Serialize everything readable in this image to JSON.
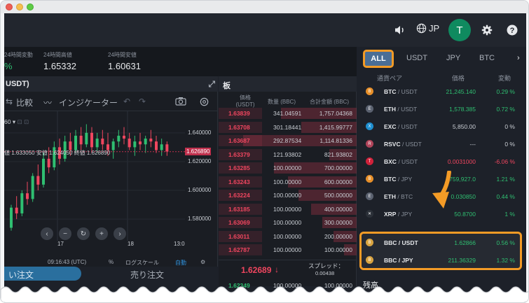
{
  "header": {
    "lang": "JP",
    "avatar_initial": "T"
  },
  "stats": {
    "change_label": "24時間変動",
    "change_value": "%",
    "high_label": "24時間高値",
    "high_value": "1.65332",
    "low_label": "24時間安値",
    "low_value": "1.60631"
  },
  "chart": {
    "title": "USDT)",
    "compare_label": "比較",
    "indicator_label": "インジケーター",
    "interval": "60",
    "ohlc_text": "値 1.633050  安値 1.624050  終値 1.626890",
    "current_price": "1.626890",
    "price_ticks": [
      "1.640000",
      "1.620000",
      "1.600000",
      "1.580000"
    ],
    "x_ticks": [
      "17",
      "18",
      "13:0"
    ],
    "time": "09:16:43 (UTC)",
    "pct": "%",
    "log_label": "ログスケール",
    "auto_label": "自動"
  },
  "chart_data": {
    "type": "candlestick",
    "title": "",
    "ylabel": "",
    "ylim": [
      1.565,
      1.655
    ],
    "categories": [
      "17",
      "18",
      "13:0"
    ],
    "series": [
      {
        "values": [
          [
            1.574,
            1.59,
            1.572,
            1.588
          ],
          [
            1.588,
            1.596,
            1.58,
            1.584
          ],
          [
            1.584,
            1.6,
            1.582,
            1.598
          ],
          [
            1.598,
            1.606,
            1.59,
            1.594
          ],
          [
            1.594,
            1.612,
            1.592,
            1.61
          ],
          [
            1.61,
            1.618,
            1.6,
            1.604
          ],
          [
            1.604,
            1.626,
            1.602,
            1.622
          ],
          [
            1.622,
            1.63,
            1.612,
            1.616
          ],
          [
            1.616,
            1.634,
            1.614,
            1.63
          ],
          [
            1.63,
            1.636,
            1.618,
            1.622
          ],
          [
            1.622,
            1.638,
            1.62,
            1.634
          ],
          [
            1.634,
            1.64,
            1.624,
            1.628
          ],
          [
            1.628,
            1.642,
            1.626,
            1.638
          ],
          [
            1.638,
            1.644,
            1.628,
            1.632
          ],
          [
            1.632,
            1.646,
            1.63,
            1.64
          ],
          [
            1.64,
            1.644,
            1.626,
            1.63
          ],
          [
            1.63,
            1.64,
            1.626,
            1.636
          ],
          [
            1.636,
            1.642,
            1.628,
            1.632
          ],
          [
            1.632,
            1.64,
            1.624,
            1.628
          ],
          [
            1.628,
            1.636,
            1.622,
            1.634
          ],
          [
            1.634,
            1.642,
            1.63,
            1.638
          ],
          [
            1.638,
            1.644,
            1.632,
            1.636
          ],
          [
            1.636,
            1.64,
            1.628,
            1.63
          ],
          [
            1.63,
            1.638,
            1.624,
            1.634
          ],
          [
            1.634,
            1.64,
            1.628,
            1.632
          ],
          [
            1.632,
            1.638,
            1.626,
            1.636
          ],
          [
            1.636,
            1.642,
            1.63,
            1.634
          ],
          [
            1.634,
            1.638,
            1.626,
            1.628
          ],
          [
            1.628,
            1.636,
            1.624,
            1.632
          ],
          [
            1.632,
            1.634,
            1.624,
            1.627
          ]
        ]
      }
    ]
  },
  "book": {
    "title": "板",
    "head_price": "価格\n(USDT)",
    "head_qty": "数量 (BBC)",
    "head_total": "合計金額 (BBC)",
    "asks": [
      {
        "price": "1.63839",
        "qty": "341.04591",
        "total": "1,757.04368",
        "depth": 0.55
      },
      {
        "price": "1.63708",
        "qty": "301.18441",
        "total": "1,415.99777",
        "depth": 0.4
      },
      {
        "price": "1.63687",
        "qty": "292.87534",
        "total": "1,114.81336",
        "depth": 0.82
      },
      {
        "price": "1.63379",
        "qty": "121.93802",
        "total": "821.93802",
        "depth": 0.2
      },
      {
        "price": "1.63285",
        "qty": "100.00000",
        "total": "700.00000",
        "depth": 0.6
      },
      {
        "price": "1.63243",
        "qty": "100.00000",
        "total": "600.00000",
        "depth": 0.5
      },
      {
        "price": "1.63224",
        "qty": "100.00000",
        "total": "500.00000",
        "depth": 0.42
      },
      {
        "price": "1.63185",
        "qty": "100.00000",
        "total": "400.00000",
        "depth": 0.33
      },
      {
        "price": "1.63069",
        "qty": "100.00000",
        "total": "300.00000",
        "depth": 0.25
      },
      {
        "price": "1.63011",
        "qty": "100.00000",
        "total": "200.00000",
        "depth": 0.17
      },
      {
        "price": "1.62787",
        "qty": "100.00000",
        "total": "100.00000",
        "depth": 0.09
      }
    ],
    "mid_price": "1.62689",
    "mid_arrow": "↓",
    "spread_label": "スプレッド：",
    "spread_value": "0.00438",
    "bid_price": "1.62349",
    "bid_qty": "100.00000",
    "bid_total": "100.00000"
  },
  "orders": {
    "buy_label": "い注文",
    "sell_label": "売り注文"
  },
  "market": {
    "tabs": [
      "ALL",
      "USDT",
      "JPY",
      "BTC"
    ],
    "head_pair": "通貨ペア",
    "head_price": "価格",
    "head_change": "変動",
    "rows": [
      {
        "base": "BTC",
        "quote": " / USDT",
        "price": "21,245.140",
        "change": "0.29 %",
        "price_color": "#2fbf71",
        "change_color": "#2fbf71",
        "icon_color": "#e8902a",
        "icon": "B"
      },
      {
        "base": "ETH",
        "quote": " / USDT",
        "price": "1,578.385",
        "change": "0.72 %",
        "price_color": "#2fbf71",
        "change_color": "#2fbf71",
        "icon_color": "#5b6270",
        "icon": "E"
      },
      {
        "base": "EXC",
        "quote": " / USDT",
        "price": "5,850.00",
        "change": "0 %",
        "price_color": "#c9cdd3",
        "change_color": "#c9cdd3",
        "icon_color": "#1e8fd0",
        "icon": "X"
      },
      {
        "base": "RSVC",
        "quote": " / USDT",
        "price": "---",
        "change": "0 %",
        "price_color": "#c9cdd3",
        "change_color": "#c9cdd3",
        "icon_color": "#b0445a",
        "icon": "R"
      },
      {
        "base": "BXC",
        "quote": " / USDT",
        "price": "0.0031000",
        "change": "-6.06 %",
        "price_color": "#f0465f",
        "change_color": "#f0465f",
        "icon_color": "#d0213a",
        "icon": "T"
      },
      {
        "base": "BTC",
        "quote": " / JPY",
        "price": "759,927.0",
        "change": "1.21 %",
        "price_color": "#2fbf71",
        "change_color": "#2fbf71",
        "icon_color": "#e8902a",
        "icon": "B"
      },
      {
        "base": "ETH",
        "quote": " / BTC",
        "price": "0.030850",
        "change": "0.44 %",
        "price_color": "#2fbf71",
        "change_color": "#2fbf71",
        "icon_color": "#5b6270",
        "icon": "E"
      },
      {
        "base": "XRP",
        "quote": " / JPY",
        "price": "50.8700",
        "change": "1 %",
        "price_color": "#2fbf71",
        "change_color": "#2fbf71",
        "icon_color": "#2b3038",
        "icon": "✕"
      },
      {
        "base": "BBC",
        "quote": " / USDT",
        "price": "1.62866",
        "change": "0.56 %",
        "price_color": "#2fbf71",
        "change_color": "#2fbf71",
        "icon_color": "#d9a441",
        "icon": "B"
      },
      {
        "base": "BBC",
        "quote": " / JPY",
        "price": "211.36329",
        "change": "1.32 %",
        "price_color": "#2fbf71",
        "change_color": "#2fbf71",
        "icon_color": "#d9a441",
        "icon": "B"
      }
    ],
    "balance_label": "残高"
  },
  "colors": {
    "highlight": "#f39b26",
    "up": "#2fbf71",
    "down": "#f0465f"
  }
}
